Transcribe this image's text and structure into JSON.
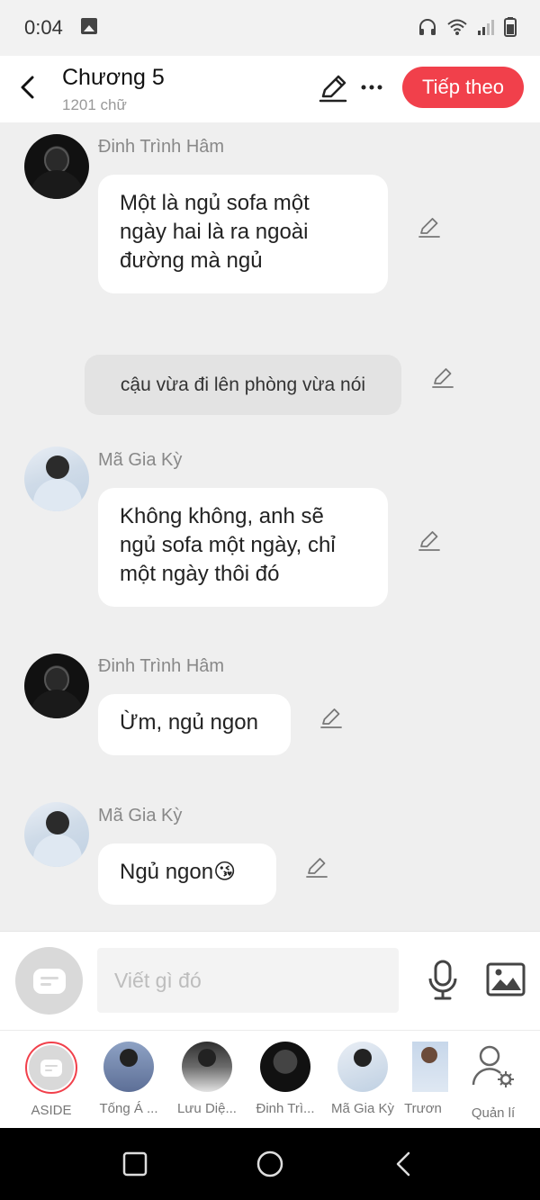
{
  "status_bar": {
    "time": "0:04",
    "icons": [
      "image-notification-icon",
      "headphones-icon",
      "wifi-icon",
      "signal-icon",
      "battery-icon"
    ]
  },
  "header": {
    "title": "Chương 5",
    "word_count": "1201 chữ",
    "next_label": "Tiếp theo",
    "icons": [
      "back-arrow-icon",
      "pencil-icon",
      "more-dots-icon"
    ]
  },
  "messages": [
    {
      "type": "character",
      "sender": "Đinh Trình Hâm",
      "lines": [
        "Một là ngủ sofa một",
        "ngày hai là ra ngoài",
        "đường mà ngủ"
      ]
    },
    {
      "type": "narration",
      "text": "cậu vừa đi lên phòng vừa nói"
    },
    {
      "type": "character",
      "sender": "Mã Gia Kỳ",
      "lines": [
        "Không không, anh sẽ",
        "ngủ sofa một ngày, chỉ",
        "một ngày thôi đó"
      ]
    },
    {
      "type": "character",
      "sender": "Đinh Trình Hâm",
      "lines": [
        "Ừm, ngủ ngon"
      ]
    },
    {
      "type": "character",
      "sender": "Mã Gia Kỳ",
      "lines": [
        "Ngủ ngon😘"
      ]
    }
  ],
  "input_bar": {
    "placeholder": "Viết gì đó",
    "icons": [
      "aside-chat-icon",
      "microphone-icon",
      "image-icon"
    ]
  },
  "characters": [
    {
      "label": "ASIDE",
      "selected": true
    },
    {
      "label": "Tống Á ..."
    },
    {
      "label": "Lưu Diệ..."
    },
    {
      "label": "Đinh Trì..."
    },
    {
      "label": "Mã Gia Kỳ"
    },
    {
      "label": "Trươn"
    },
    {
      "label": "Quản lí"
    }
  ],
  "nav_bar": {
    "icons": [
      "recent-apps-icon",
      "home-icon",
      "back-icon"
    ]
  },
  "colors": {
    "accent": "#f1404b",
    "background": "#efefef",
    "bubble": "#ffffff",
    "narration": "#e3e3e3"
  }
}
